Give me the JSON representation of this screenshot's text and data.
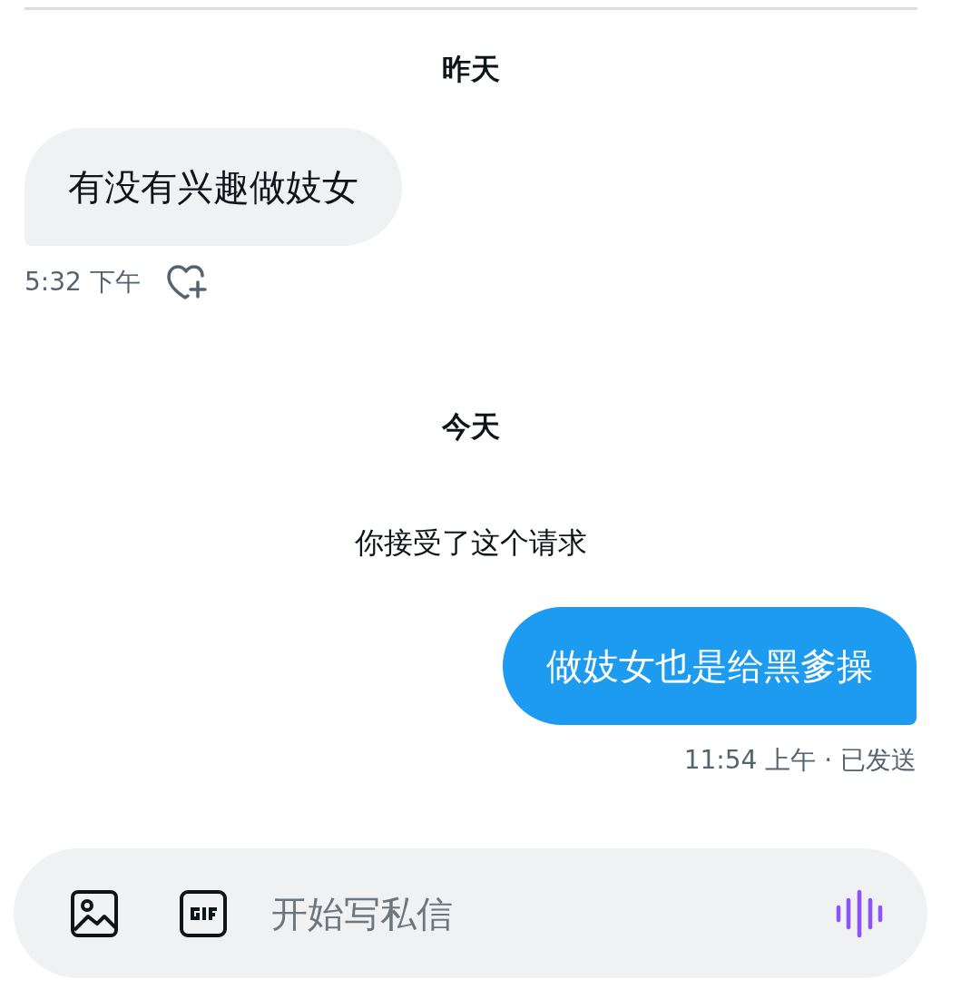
{
  "items": [
    {
      "kind": "date",
      "text": "昨天"
    },
    {
      "kind": "incoming",
      "text": "有没有兴趣做妓女",
      "meta": "5:32 下午"
    },
    {
      "kind": "date",
      "text": "今天"
    },
    {
      "kind": "system",
      "text": "你接受了这个请求"
    },
    {
      "kind": "outgoing",
      "text": "做妓女也是给黑爹操",
      "meta": "11:54 上午 · 已发送"
    }
  ],
  "composer": {
    "placeholder": "开始写私信"
  }
}
